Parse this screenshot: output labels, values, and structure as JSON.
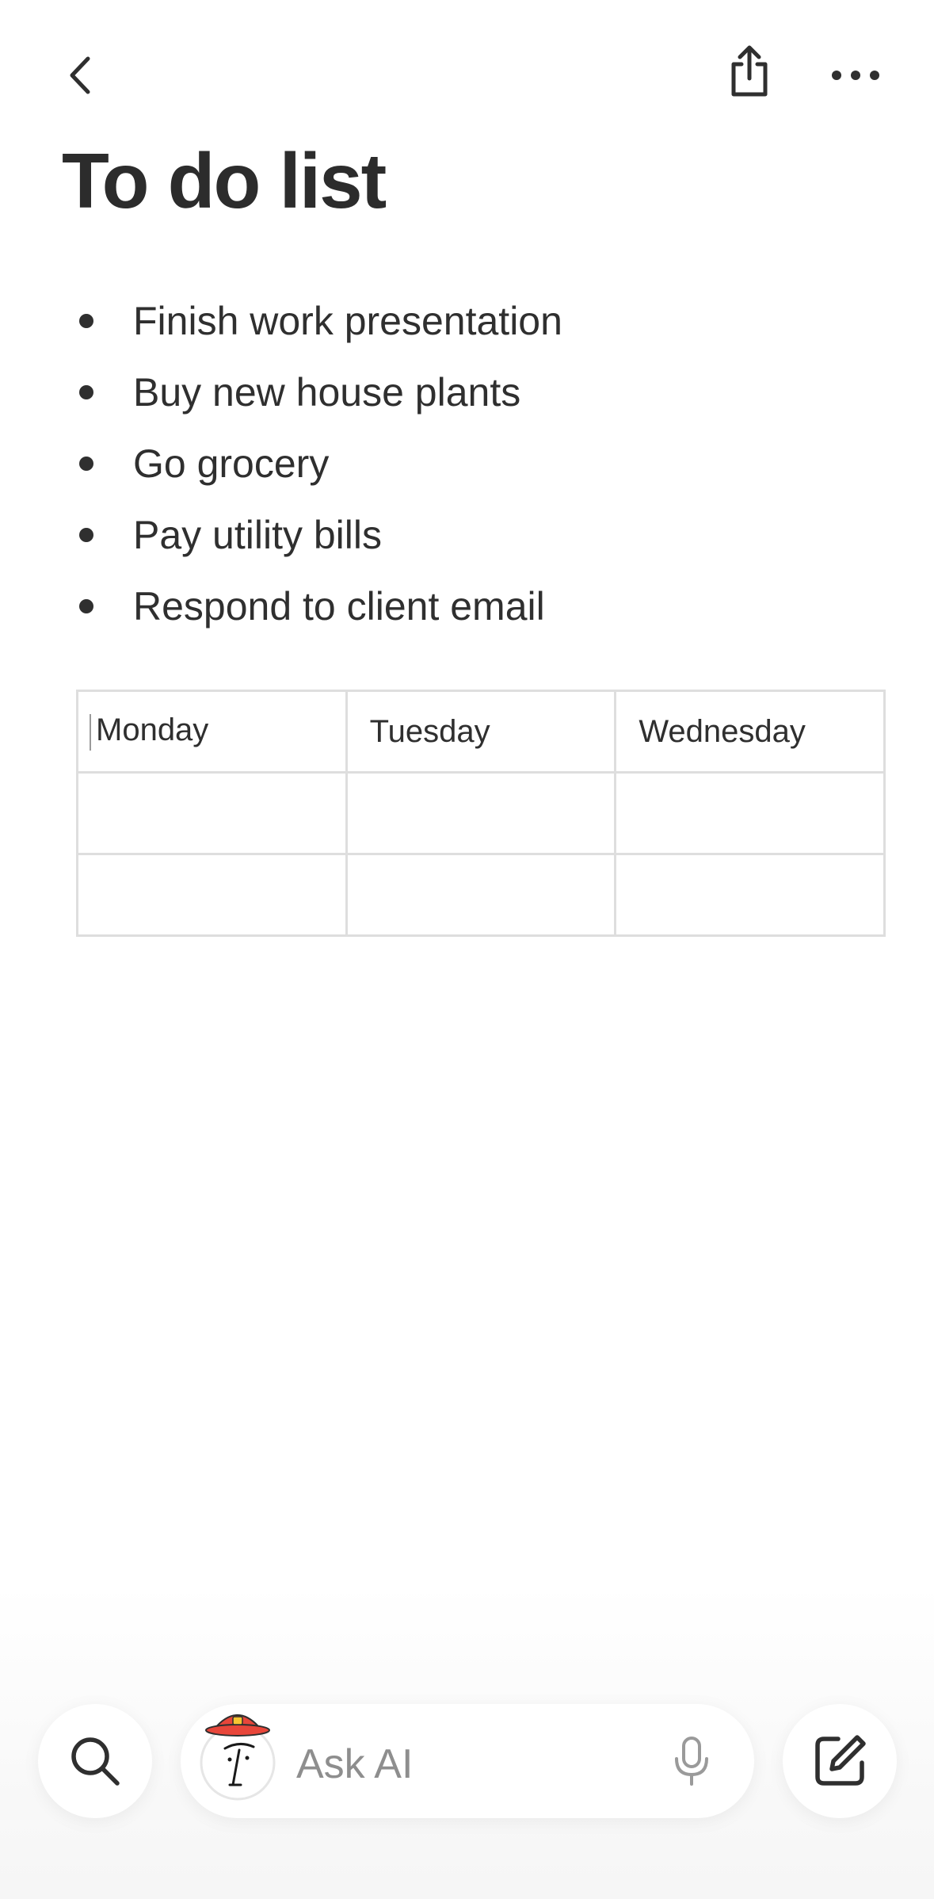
{
  "header": {
    "back_icon": "chevron-left-icon",
    "share_icon": "share-icon",
    "more_icon": "more-horizontal-icon"
  },
  "page": {
    "title": "To do list"
  },
  "todo_items": [
    "Finish work presentation",
    "Buy new house plants",
    "Go grocery",
    "Pay utility bills",
    "Respond to client email"
  ],
  "table": {
    "headers": [
      "Monday",
      "Tuesday",
      "Wednesday"
    ],
    "rows": [
      [
        "",
        "",
        ""
      ],
      [
        "",
        "",
        ""
      ]
    ]
  },
  "bottom_bar": {
    "search_icon": "search-icon",
    "ask_placeholder": "Ask AI",
    "avatar_icon": "ai-face-avatar-icon",
    "mic_icon": "microphone-icon",
    "compose_icon": "compose-icon"
  },
  "colors": {
    "text": "#2f2f2f",
    "table_border": "#dedede",
    "placeholder": "#8e8e8e",
    "hat_red": "#e8463a",
    "hat_yellow": "#f7c531"
  }
}
